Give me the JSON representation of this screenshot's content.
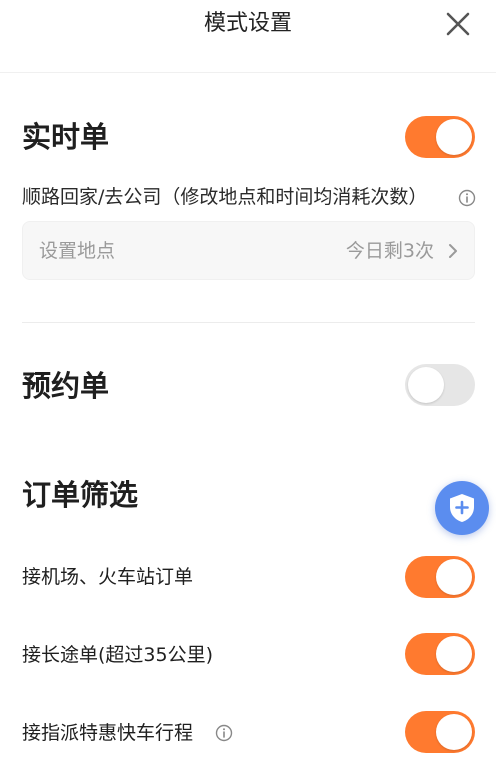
{
  "header": {
    "title": "模式设置",
    "close_icon": "close-icon"
  },
  "realtime": {
    "title": "实时单",
    "enabled": true,
    "subtitle": "顺路回家/去公司（修改地点和时间均消耗次数）",
    "info_icon": "info-icon",
    "location": {
      "placeholder": "设置地点",
      "remaining": "今日剩3次",
      "chevron_icon": "chevron-right-icon"
    }
  },
  "reservation": {
    "title": "预约单",
    "enabled": false
  },
  "filter": {
    "title": "订单筛选",
    "items": [
      {
        "label": "接机场、火车站订单",
        "enabled": true
      },
      {
        "label": "接长途单(超过35公里)",
        "enabled": true
      },
      {
        "label": "接指派特惠快车行程",
        "enabled": true,
        "info_icon": "info-icon"
      }
    ]
  },
  "fab": {
    "icon": "shield-plus-icon"
  },
  "colors": {
    "toggle_on": "#ff7a2f",
    "toggle_off": "#e6e6e6",
    "fab": "#5b8def"
  }
}
